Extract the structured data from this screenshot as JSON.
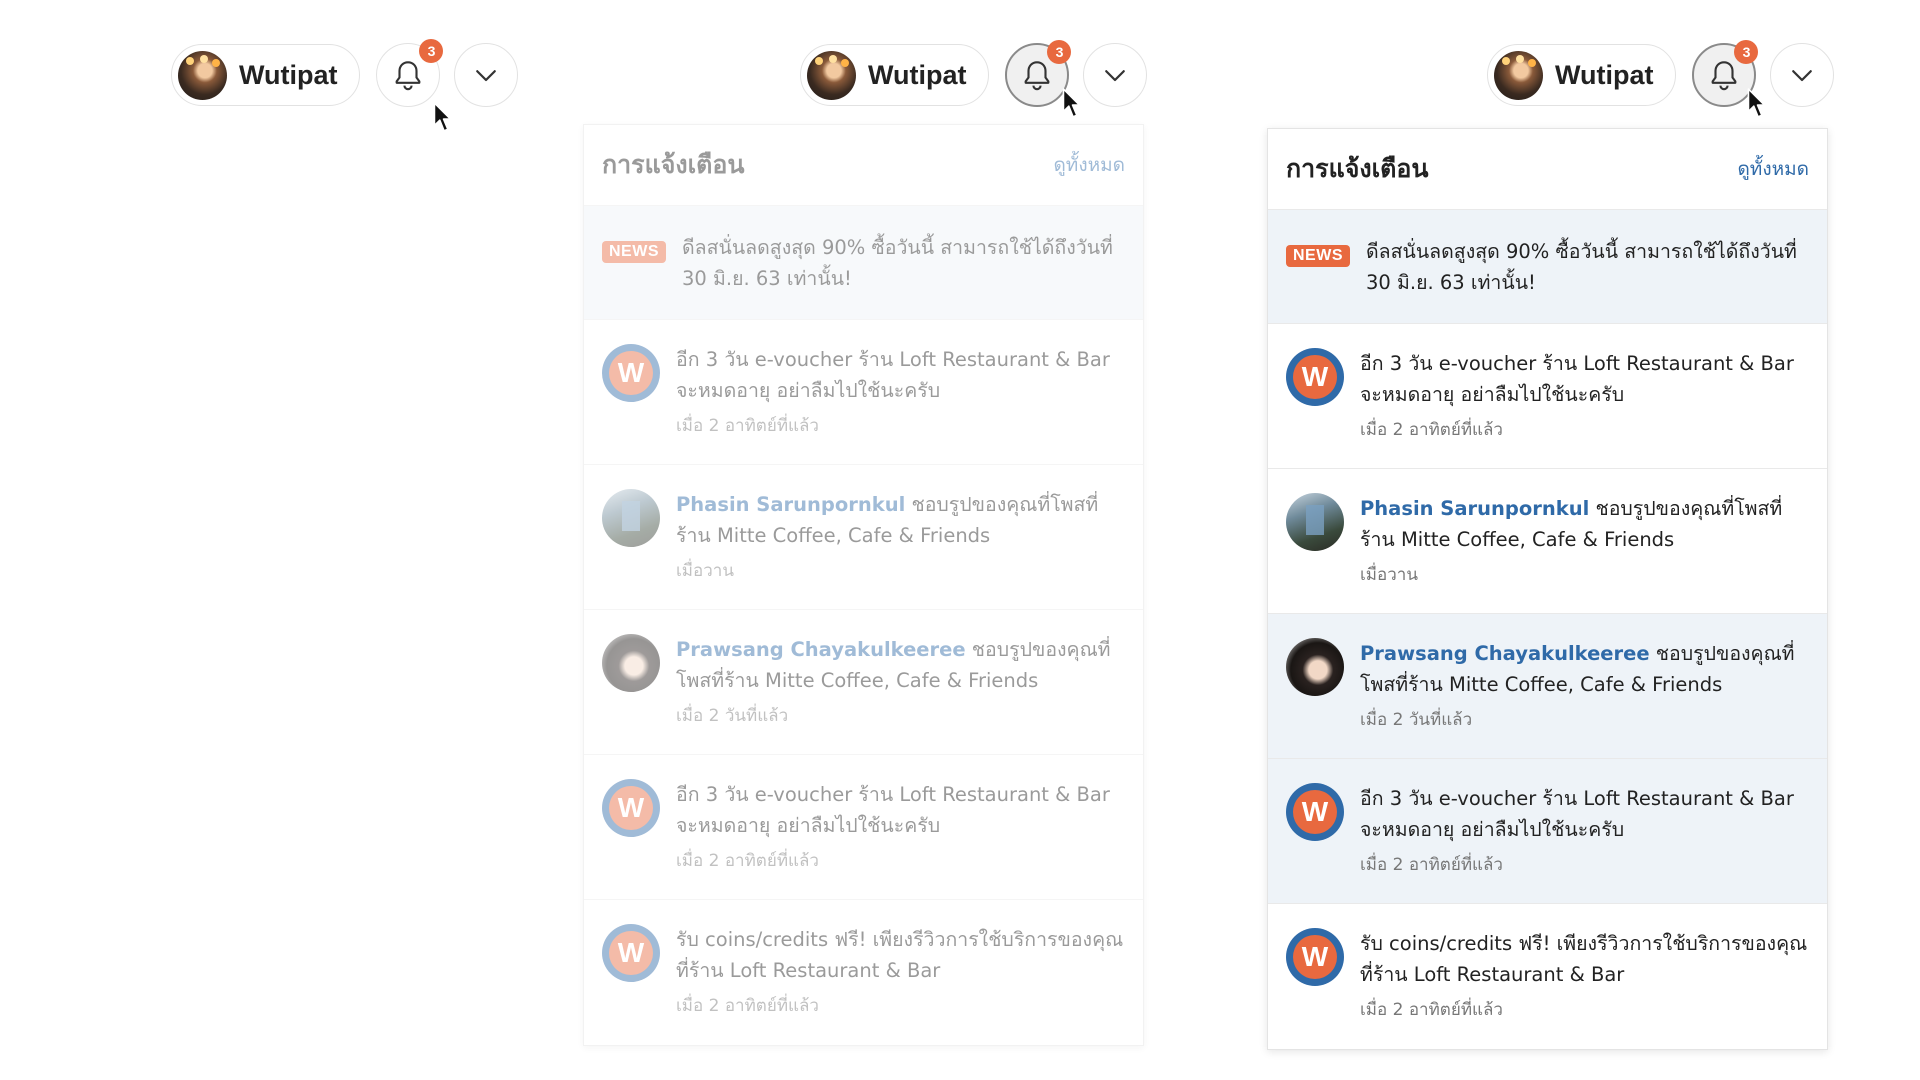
{
  "user": {
    "name": "Wutipat"
  },
  "notification_count": "3",
  "panel": {
    "title": "การแจ้งเตือน",
    "view_all": "ดูทั้งหมด",
    "news": {
      "tag": "NEWS",
      "text": "ดีลสนั่นลดสูงสุด 90% ซื้อวันนี้ สามารถใช้ได้ถึงวันที่ 30 มิ.ย. 63 เท่านั้น!"
    },
    "items": [
      {
        "icon": "wongnai-logo-icon",
        "user": "",
        "text": "อีก 3 วัน e-voucher ร้าน Loft Restaurant & Bar จะหมดอายุ อย่าลืมไปใช้นะครับ",
        "time": "เมื่อ 2 อาทิตย์ที่แล้ว",
        "unread": false
      },
      {
        "icon": "user-avatar",
        "user": "Phasin Sarunpornkul",
        "text": " ชอบรูปของคุณที่โพสที่ร้าน Mitte Coffee, Cafe & Friends",
        "time": "เมื่อวาน",
        "unread": false
      },
      {
        "icon": "user-avatar",
        "user": "Prawsang Chayakulkeeree",
        "text": " ชอบรูปของคุณที่โพสที่ร้าน Mitte Coffee, Cafe & Friends",
        "time": "เมื่อ 2 วันที่แล้ว",
        "unread": true
      },
      {
        "icon": "wongnai-logo-icon",
        "user": "",
        "text": "อีก 3 วัน e-voucher ร้าน Loft Restaurant & Bar จะหมดอายุ อย่าลืมไปใช้นะครับ",
        "time": "เมื่อ 2 อาทิตย์ที่แล้ว",
        "unread": true
      },
      {
        "icon": "wongnai-logo-icon",
        "user": "",
        "text": "รับ coins/credits ฟรี! เพียงรีวิวการใช้บริการของคุณที่ร้าน Loft Restaurant & Bar",
        "time": "เมื่อ 2 อาทิตย์ที่แล้ว",
        "unread": false
      }
    ]
  },
  "colors": {
    "accent_orange": "#e8693f",
    "link_blue": "#2f6aa8",
    "unread_bg": "#eef3f8"
  }
}
